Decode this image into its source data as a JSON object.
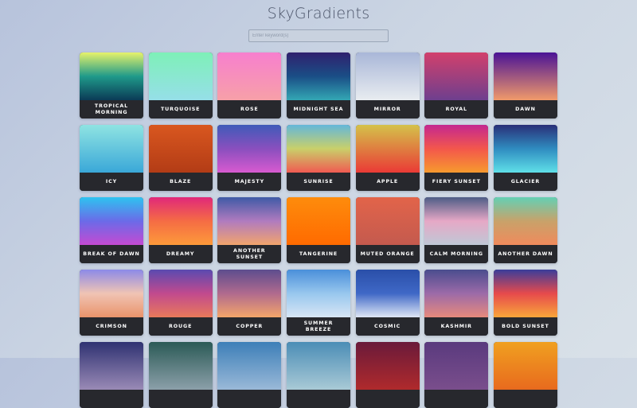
{
  "app": {
    "title": "SkyGradients"
  },
  "search": {
    "placeholder": "Enter keyword(s)"
  },
  "gradients": [
    {
      "name": "TROPICAL MORNING",
      "colors": [
        "#e6f26a",
        "#1f9a8a",
        "#0b3a56"
      ]
    },
    {
      "name": "TURQUOISE",
      "colors": [
        "#7ef0b8",
        "#96dfe8"
      ]
    },
    {
      "name": "ROSE",
      "colors": [
        "#f77fce",
        "#f7a0a8"
      ]
    },
    {
      "name": "MIDNIGHT SEA",
      "colors": [
        "#30206e",
        "#1a4e86",
        "#33a7b4"
      ]
    },
    {
      "name": "MIRROR",
      "colors": [
        "#a9b7d8",
        "#e8ecf0"
      ]
    },
    {
      "name": "ROYAL",
      "colors": [
        "#d2406c",
        "#6e3f8e"
      ]
    },
    {
      "name": "DAWN",
      "colors": [
        "#4a1396",
        "#f19a6a"
      ]
    },
    {
      "name": "ICY",
      "colors": [
        "#8fe4e2",
        "#3aa8d8"
      ]
    },
    {
      "name": "BLAZE",
      "colors": [
        "#d9571f",
        "#b33c16"
      ]
    },
    {
      "name": "MAJESTY",
      "colors": [
        "#3f5bb9",
        "#8a4fbe",
        "#d85ad0"
      ]
    },
    {
      "name": "SUNRISE",
      "colors": [
        "#64b7d9",
        "#c9d06a",
        "#f05a52"
      ]
    },
    {
      "name": "APPLE",
      "colors": [
        "#d4c24a",
        "#ea3a36"
      ]
    },
    {
      "name": "FIERY SUNSET",
      "colors": [
        "#c42790",
        "#f3574c",
        "#f79a2e"
      ]
    },
    {
      "name": "GLACIER",
      "colors": [
        "#2a2f78",
        "#2f8cc0",
        "#5fe0e8"
      ]
    },
    {
      "name": "BREAK OF DAWN",
      "colors": [
        "#2ec3f0",
        "#6b6be8",
        "#c44ad2"
      ]
    },
    {
      "name": "DREAMY",
      "colors": [
        "#e0287a",
        "#f56c44",
        "#fd9a3a"
      ]
    },
    {
      "name": "ANOTHER SUNSET",
      "colors": [
        "#3f5aa6",
        "#b07bbf",
        "#f2a46c"
      ]
    },
    {
      "name": "TANGERINE",
      "colors": [
        "#fe8c0c",
        "#ff6a00"
      ]
    },
    {
      "name": "MUTED ORANGE",
      "colors": [
        "#e2644a",
        "#c45a4e"
      ]
    },
    {
      "name": "CALM MORNING",
      "colors": [
        "#4d5d86",
        "#e6a8c6",
        "#bfc8d6"
      ]
    },
    {
      "name": "ANOTHER DAWN",
      "colors": [
        "#64d0b4",
        "#c8a26a",
        "#f08a5c"
      ]
    },
    {
      "name": "CRIMSON",
      "colors": [
        "#8c8ae8",
        "#f0c4b4",
        "#e9936a"
      ]
    },
    {
      "name": "ROUGE",
      "colors": [
        "#5a4ab0",
        "#c14a8e",
        "#e97a5a"
      ]
    },
    {
      "name": "COPPER",
      "colors": [
        "#5d4d8e",
        "#b06a8e",
        "#f4a66a"
      ]
    },
    {
      "name": "SUMMER BREEZE",
      "colors": [
        "#4a8fda",
        "#98c7ee",
        "#d8e6f5"
      ]
    },
    {
      "name": "COSMIC",
      "colors": [
        "#2a4fa8",
        "#3f68c6",
        "#dfe6f5"
      ]
    },
    {
      "name": "KASHMIR",
      "colors": [
        "#4a4d8e",
        "#9c6aa8",
        "#e78a7c"
      ]
    },
    {
      "name": "BOLD SUNSET",
      "colors": [
        "#3a3d9a",
        "#e64a4c",
        "#f9a63a"
      ]
    },
    {
      "name": "",
      "colors": [
        "#2f3272",
        "#9a8ab6"
      ]
    },
    {
      "name": "",
      "colors": [
        "#2b5a56",
        "#8ca0aa"
      ]
    },
    {
      "name": "",
      "colors": [
        "#3d7fb8",
        "#9ab9d8"
      ]
    },
    {
      "name": "",
      "colors": [
        "#4b8db6",
        "#a9cad6"
      ]
    },
    {
      "name": "",
      "colors": [
        "#6a1a3a",
        "#b02a2c"
      ]
    },
    {
      "name": "",
      "colors": [
        "#5a3a7e",
        "#7a4e8c"
      ]
    },
    {
      "name": "",
      "colors": [
        "#f0a020",
        "#e86a1e"
      ]
    }
  ]
}
